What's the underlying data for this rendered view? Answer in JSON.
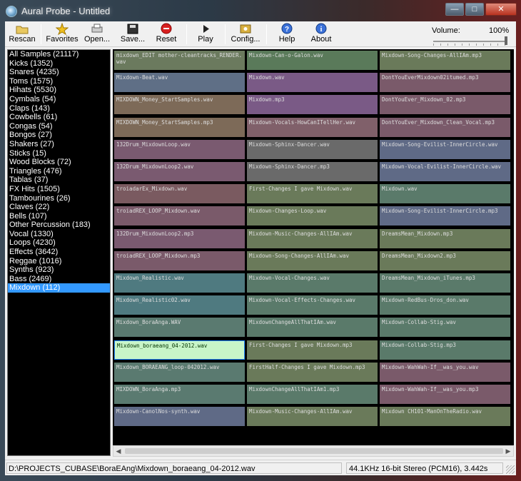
{
  "window": {
    "title": "Aural Probe - Untitled",
    "buttons": {
      "minimize": "—",
      "maximize": "□",
      "close": "✕"
    }
  },
  "toolbar": {
    "buttons": [
      {
        "label": "Rescan",
        "icon": "folder-open-icon"
      },
      {
        "label": "Favorites",
        "icon": "star-icon"
      },
      {
        "label": "Open...",
        "icon": "printer-icon"
      },
      {
        "label": "Save...",
        "icon": "disk-icon"
      },
      {
        "label": "Reset",
        "icon": "stop-icon"
      },
      {
        "label": "Play",
        "icon": "play-icon"
      },
      {
        "label": "Config...",
        "icon": "config-icon"
      },
      {
        "label": "Help",
        "icon": "help-icon"
      },
      {
        "label": "About",
        "icon": "info-icon"
      }
    ],
    "volume_label": "Volume:",
    "volume_value": "100%",
    "volume_level": 1.0
  },
  "sidebar": {
    "categories": [
      "All Samples (21117)",
      "Kicks (1352)",
      "Snares (4235)",
      "Toms (1575)",
      "Hihats (5530)",
      "Cymbals (54)",
      "Claps (143)",
      "Cowbells (61)",
      "Congas (54)",
      "Bongos (27)",
      "Shakers (27)",
      "Sticks (15)",
      "Wood Blocks (72)",
      "Triangles (476)",
      "Tablas (37)",
      "FX Hits (1505)",
      "Tambourines (26)",
      "Claves (22)",
      "Bells (107)",
      "Other Percussion (183)",
      "Vocal (1330)",
      "Loops (4230)",
      "Effects (3642)",
      "Reggae (1016)",
      "Synths (923)",
      "Bass (2469)",
      "Mixdown (112)"
    ],
    "selected_index": 26
  },
  "grid": {
    "columns": [
      [
        {
          "name": "mixdown_EDIT mother-cleantracks_RENDER.wav",
          "color": "#6b7a5e"
        },
        {
          "name": "Mixdown-Beat.wav",
          "color": "#5f6f86"
        },
        {
          "name": "MIXDOWN_Money_StartSamples.wav",
          "color": "#7d6a58"
        },
        {
          "name": "MIXDOWN_Money_StartSamples.mp3",
          "color": "#7d6a58"
        },
        {
          "name": "132Drum_MixdownLoop.wav",
          "color": "#7a5a70"
        },
        {
          "name": "132Drum_MixdownLoop2.wav",
          "color": "#7a5a70"
        },
        {
          "name": "troiadarEx_Mixdown.wav",
          "color": "#7a5a60"
        },
        {
          "name": "troiadREX_LOOP_Mixdown.wav",
          "color": "#7a5a6a"
        },
        {
          "name": "132Drum_MixdownLoop2.mp3",
          "color": "#7a5a70"
        },
        {
          "name": "troiadREX_LOOP_Mixdown.mp3",
          "color": "#7a5a6a"
        },
        {
          "name": "Mixdown_Realistic.wav",
          "color": "#4f7a80"
        },
        {
          "name": "Mixdown_Realistic02.wav",
          "color": "#4f7a80"
        },
        {
          "name": "Mixdown_BoraAnga.WAV",
          "color": "#5a7a70"
        },
        {
          "name": "Mixdown_boraeang_04-2012.wav",
          "color": "#c8f5c8"
        },
        {
          "name": "Mixdown_BORAEANG_loop-042012.wav",
          "color": "#5a7a70"
        },
        {
          "name": "MIXDOWN_BoraAnga.mp3",
          "color": "#5a7a70"
        },
        {
          "name": "Mixdown-CanolNos-synth.wav",
          "color": "#5f6a86"
        }
      ],
      [
        {
          "name": "Mixdown-Can-o-Galon.wav",
          "color": "#5a7a5a"
        },
        {
          "name": "Mixdown.wav",
          "color": "#7a5a86"
        },
        {
          "name": "Mixdown.mp3",
          "color": "#7a5a86"
        },
        {
          "name": "Mixdown-Vocals-HowCanITellHer.wav",
          "color": "#80606a"
        },
        {
          "name": "Mixdown-Sphinx-Dancer.wav",
          "color": "#6a6a6a"
        },
        {
          "name": "Mixdown-Sphinx-Dancer.mp3",
          "color": "#6a6a6a"
        },
        {
          "name": "First-Changes I gave Mixdown.wav",
          "color": "#6a7a5a"
        },
        {
          "name": "Mixdown-Changes-Loop.wav",
          "color": "#6a7a5a"
        },
        {
          "name": "Mixdown-Music-Changes-AllIAm.wav",
          "color": "#6a7a5a"
        },
        {
          "name": "Mixdown-Song-Changes-AllIAm.wav",
          "color": "#6a7a5a"
        },
        {
          "name": "Mixdown-Vocal-Changes.wav",
          "color": "#5a7a6a"
        },
        {
          "name": "Mixdown-Vocal-Effects-Changes.wav",
          "color": "#5a7a6a"
        },
        {
          "name": "MixdownChangeAllThatIAm.wav",
          "color": "#5a7a6a"
        },
        {
          "name": "First-Changes I gave Mixdown.mp3",
          "color": "#6a7a5a"
        },
        {
          "name": "FirstHalf-Changes I gave Mixdown.mp3",
          "color": "#6a7a5a"
        },
        {
          "name": "MixdownChangeAllThatIAm1.mp3",
          "color": "#5a7a6a"
        },
        {
          "name": "Mixdown-Music-Changes-AllIAm.wav",
          "color": "#6a7a5a"
        }
      ],
      [
        {
          "name": "Mixdown-Song-Changes-AllIAm.mp3",
          "color": "#6a7a5a"
        },
        {
          "name": "DontYouEverMixdown02itumed.mp3",
          "color": "#7a5a6a"
        },
        {
          "name": "DontYouEver_Mixdown_02.mp3",
          "color": "#7a5a6a"
        },
        {
          "name": "DontYouEver_Mixdown_Clean_Vocal.mp3",
          "color": "#7a5a6a"
        },
        {
          "name": "Mixdown-Song-Evilist-InnerCircle.wav",
          "color": "#5f6a86"
        },
        {
          "name": "Mixdown-Vocal-Evilist-InnerCircle.wav",
          "color": "#5f6a86"
        },
        {
          "name": "Mixdown.wav",
          "color": "#5a7a6a"
        },
        {
          "name": "Mixdown-Song-Evilist-InnerCircle.mp3",
          "color": "#5f6a86"
        },
        {
          "name": "DreamsMean_Mixdown.mp3",
          "color": "#6a7a5a"
        },
        {
          "name": "DreamsMean_Mixdown2.mp3",
          "color": "#6a7a5a"
        },
        {
          "name": "DreamsMean_Mixdown_iTunes.mp3",
          "color": "#5a7a6a"
        },
        {
          "name": "Mixdown-RedBus-Dros_don.wav",
          "color": "#5a7a6a"
        },
        {
          "name": "Mixdown-Collab-Stig.wav",
          "color": "#5a7a6a"
        },
        {
          "name": "Mixdown-Collab-Stig.mp3",
          "color": "#5a7a6a"
        },
        {
          "name": "Mixdown-WahWah-If__was_you.wav",
          "color": "#7a5a6a"
        },
        {
          "name": "Mixdown-WahWah-If__was_you.mp3",
          "color": "#7a5a6a"
        },
        {
          "name": "Mixdown CH101-ManOnTheRadio.wav",
          "color": "#6a7a5a"
        }
      ]
    ]
  },
  "scrollbar": {
    "left_arrow": "◀",
    "right_arrow": "▶"
  },
  "status": {
    "path": "D:\\PROJECTS_CUBASE\\BoraEAng\\Mixdown_boraeang_04-2012.wav",
    "info": "44.1KHz 16-bit Stereo (PCM16), 3.442s"
  }
}
